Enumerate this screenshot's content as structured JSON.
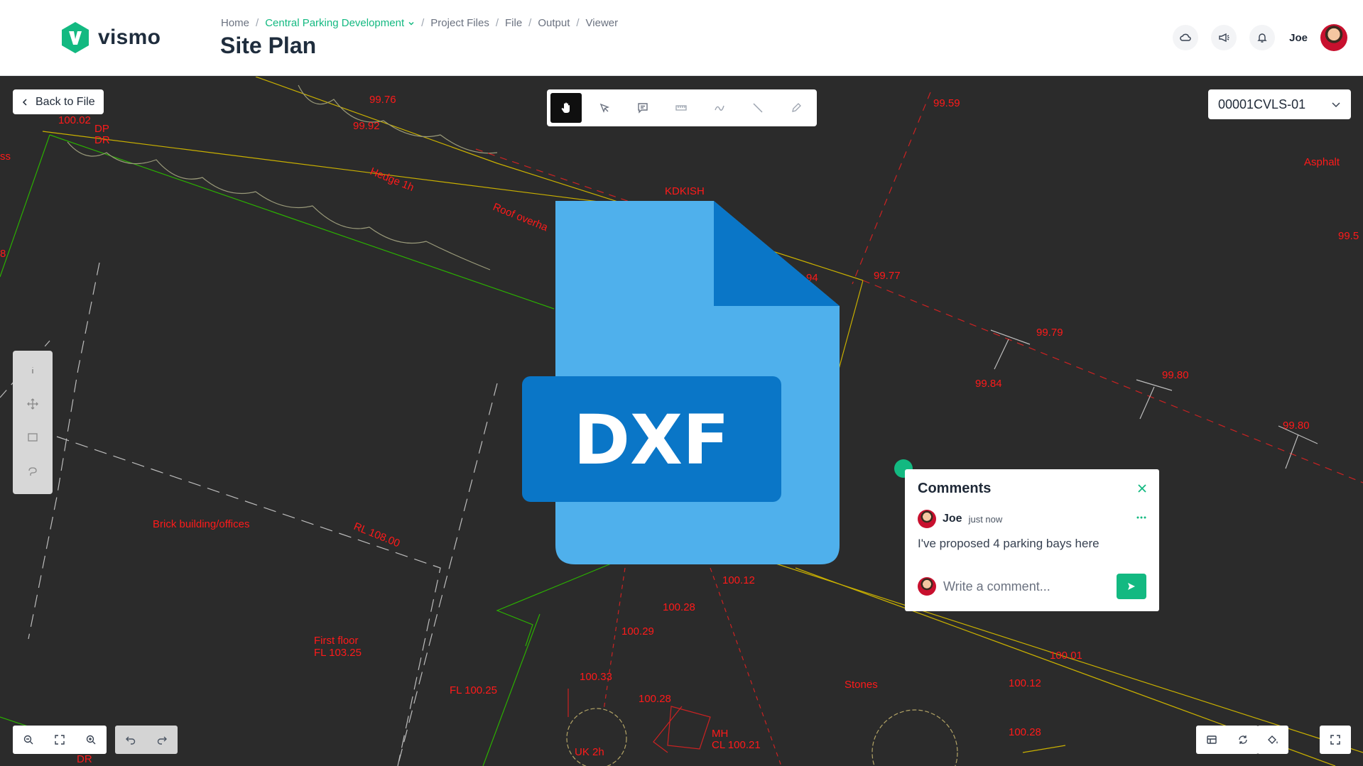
{
  "brand": {
    "name": "vismo",
    "accent": "#13b981"
  },
  "breadcrumb": {
    "items": [
      "Home",
      "Central Parking Development",
      "Project Files",
      "File",
      "Output",
      "Viewer"
    ]
  },
  "page_title": "Site Plan",
  "header": {
    "user_name": "Joe",
    "icons": [
      "cloud-icon",
      "megaphone-icon",
      "bell-icon"
    ]
  },
  "viewer": {
    "back_label": "Back to File",
    "sheet": "00001CVLS-01",
    "toolbar": [
      "hand-icon",
      "select-icon",
      "comment-icon",
      "measure-icon",
      "markup-icon",
      "line-icon",
      "pencil-icon"
    ],
    "side_tools": [
      "info-icon",
      "move-icon",
      "rectangle-icon",
      "lasso-icon"
    ],
    "file_type": "DXF"
  },
  "cad_labels": {
    "l1": "99.76",
    "l2": "99.92",
    "l3": "100.02",
    "l4": "DP",
    "l5": "DR",
    "l6": "Hedge 1h",
    "l7": "Roof overha",
    "l8": "KDKISH",
    "l9": "99.59",
    "l10": "Asphalt",
    "l11": "99.77",
    "l12": "99.79",
    "l13": "99.84",
    "l14": "99.80",
    "l15": "99.80",
    "l16": "Brick building/offices",
    "l17": "RL 108.00",
    "l18": "100.12",
    "l19": "100.28",
    "l20": "100.29",
    "l21": "First floor",
    "l22": "FL 103.25",
    "l23": "FL 100.25",
    "l24": "100.33",
    "l25": "100.28",
    "l26": "UK 2h",
    "l27": "MH",
    "l28": "CL 100.21",
    "l29": "Stones",
    "l30": "100.01",
    "l31": "100.12",
    "l32": "100.28",
    "l33": "94",
    "l34": "ss",
    "l35": "99.5",
    "l36": "8",
    "l37": "DR"
  },
  "comments": {
    "title": "Comments",
    "items": [
      {
        "author": "Joe",
        "time": "just now",
        "text": "I've proposed 4 parking bays here"
      }
    ],
    "input_placeholder": "Write a comment..."
  }
}
